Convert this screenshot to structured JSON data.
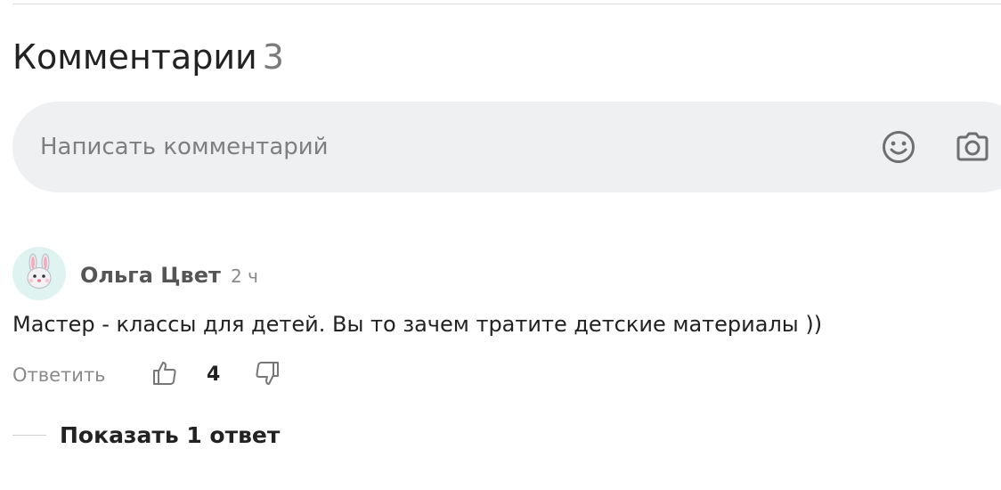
{
  "comments_section": {
    "title": "Комментарии",
    "count": "3"
  },
  "composer": {
    "placeholder": "Написать комментарий",
    "emoji_icon": "smiley-icon",
    "camera_icon": "camera-icon"
  },
  "comment": {
    "avatar_icon": "rabbit-face-icon",
    "author": "Ольга Цвет",
    "time": "2 ч",
    "text": "Мастер - классы для детей. Вы то зачем тратите детские материалы ))",
    "reply_label": "Ответить",
    "likes": "4",
    "like_icon": "thumbs-up-icon",
    "dislike_icon": "thumbs-down-icon"
  },
  "replies": {
    "show_label": "Показать 1 ответ"
  },
  "colors": {
    "composer_bg": "#eef0f2",
    "avatar_bg": "#dff3f1",
    "muted_text": "#8a8a8a",
    "primary_text": "#222222"
  }
}
